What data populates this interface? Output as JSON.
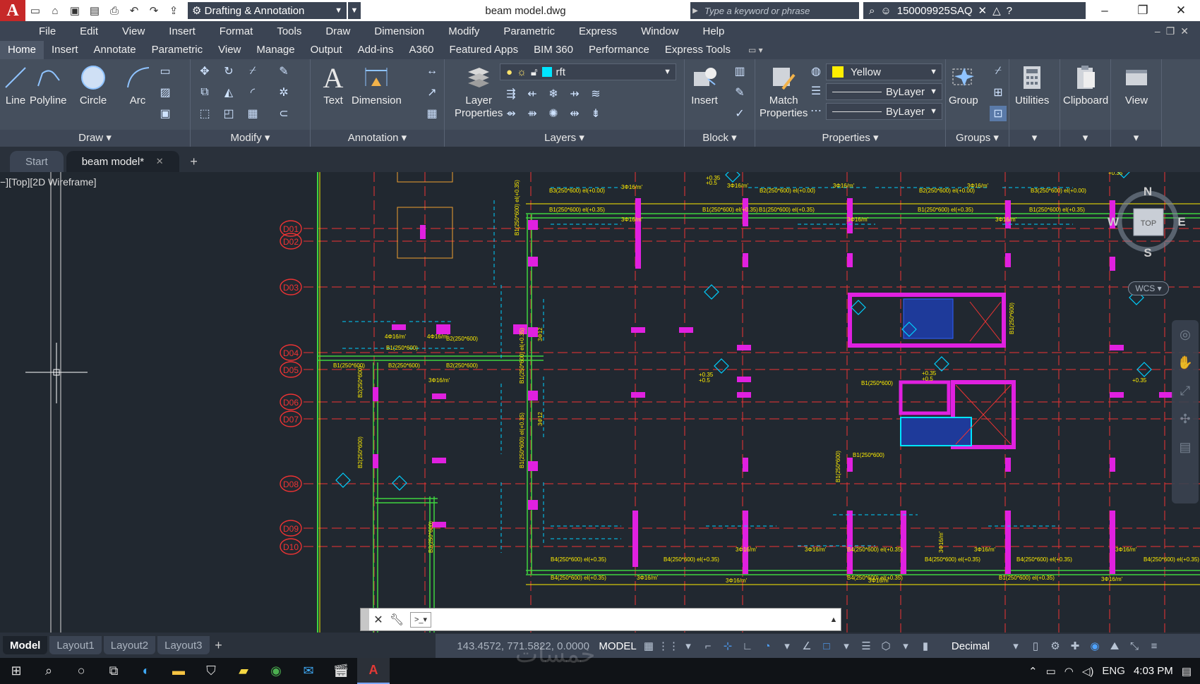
{
  "titlebar": {
    "workspace": "Drafting & Annotation",
    "document_title": "beam model.dwg",
    "search_placeholder": "Type a keyword or phrase",
    "user": "150009925SAQ"
  },
  "menu": [
    "File",
    "Edit",
    "View",
    "Insert",
    "Format",
    "Tools",
    "Draw",
    "Dimension",
    "Modify",
    "Parametric",
    "Express",
    "Window",
    "Help"
  ],
  "ribbon_tabs": [
    "Home",
    "Insert",
    "Annotate",
    "Parametric",
    "View",
    "Manage",
    "Output",
    "Add-ins",
    "A360",
    "Featured Apps",
    "BIM 360",
    "Performance",
    "Express Tools"
  ],
  "ribbon": {
    "draw": {
      "title": "Draw",
      "line": "Line",
      "polyline": "Polyline",
      "circle": "Circle",
      "arc": "Arc"
    },
    "modify": {
      "title": "Modify"
    },
    "annotation": {
      "title": "Annotation",
      "text": "Text",
      "dimension": "Dimension"
    },
    "layers": {
      "title": "Layers",
      "layer_properties_1": "Layer",
      "layer_properties_2": "Properties",
      "current_layer": "rft"
    },
    "block": {
      "title": "Block",
      "insert": "Insert"
    },
    "properties": {
      "title": "Properties",
      "match_1": "Match",
      "match_2": "Properties",
      "color": "Yellow",
      "linetype": "ByLayer",
      "lineweight": "ByLayer"
    },
    "groups": {
      "title": "Groups",
      "group": "Group"
    },
    "utilities": "Utilities",
    "clipboard": "Clipboard",
    "view": "View"
  },
  "doc_tabs": {
    "start": "Start",
    "active": "beam model*"
  },
  "canvas": {
    "viewport_label": "−][Top][2D Wireframe]",
    "grid_labels": [
      "D01",
      "D02",
      "D03",
      "D04",
      "D05",
      "D06",
      "D07",
      "D08",
      "D09",
      "D10"
    ],
    "beam_labels": [
      "B3(250*600) el(+0.00)",
      "B1(250*600) el(+0.35)",
      "B2(250*600) el(+0.00)",
      "B4(250*600) el(+0.35)",
      "B1(250*600)",
      "B2(250*600)",
      "3Φ16/m'",
      "4Φ16/m'",
      "3Φ12"
    ],
    "elev_labels": [
      "+0.35",
      "+0.5",
      "250"
    ],
    "viewcube": {
      "n": "N",
      "s": "S",
      "e": "E",
      "w": "W",
      "top": "TOP"
    },
    "wcs": "WCS"
  },
  "command_line": {
    "input": ""
  },
  "layout_tabs": [
    "Model",
    "Layout1",
    "Layout2",
    "Layout3"
  ],
  "status": {
    "coords": "143.4572, 771.5822, 0.0000",
    "mode": "MODEL",
    "units": "Decimal"
  },
  "taskbar": {
    "language": "ENG",
    "time": "4:03 PM"
  },
  "watermark": "خمسات"
}
